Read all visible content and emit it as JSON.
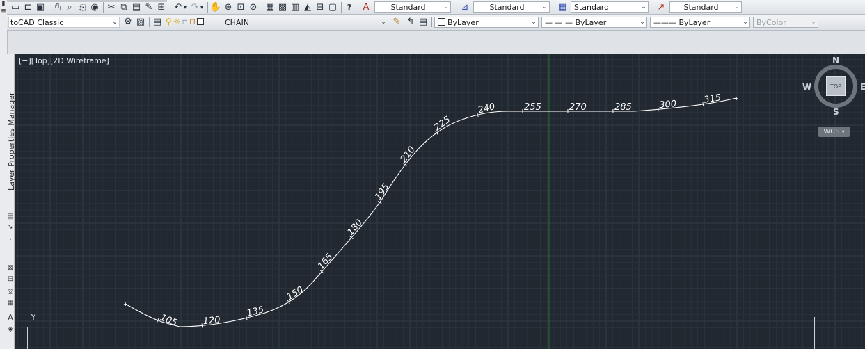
{
  "toolbar_top": {
    "text_style": "Standard",
    "dim_style": "Standard",
    "table_style": "Standard",
    "multileader_style": "Standard",
    "icons": [
      "new-icon",
      "open-icon",
      "save-icon",
      "plot-icon",
      "plot-preview-icon",
      "publish-icon",
      "3d-print-icon",
      "cut-icon",
      "copy-icon",
      "paste-icon",
      "match-properties-icon",
      "block-editor-icon",
      "undo-icon",
      "redo-icon",
      "pan-icon",
      "zoom-realtime-icon",
      "zoom-window-icon",
      "zoom-previous-icon",
      "properties-icon",
      "design-center-icon",
      "tool-palettes-icon",
      "sheet-set-icon",
      "markup-icon",
      "quickcalc-icon",
      "help-icon"
    ]
  },
  "toolbar_layers": {
    "workspace": "AutoCAD Classic",
    "workspace_visible": "toCAD Classic",
    "current_layer": "CHAIN",
    "color": "ByLayer",
    "linetype": "ByLayer",
    "lineweight": "ByLayer",
    "plot_style": "ByColor"
  },
  "palette": {
    "title": "Layer Properties Manager"
  },
  "viewport": {
    "view_label": "[−][Top][2D Wireframe]",
    "background": "#212830",
    "curve_color": "#ffffff",
    "ucs_axis_label": "Y"
  },
  "viewcube": {
    "north": "N",
    "south": "S",
    "east": "E",
    "west": "W",
    "face": "TOP",
    "wcs": "WCS"
  },
  "chain_stations": {
    "labels": [
      "105",
      "120",
      "135",
      "150",
      "165",
      "180",
      "195",
      "210",
      "225",
      "240",
      "255",
      "270",
      "285",
      "300",
      "315"
    ]
  }
}
